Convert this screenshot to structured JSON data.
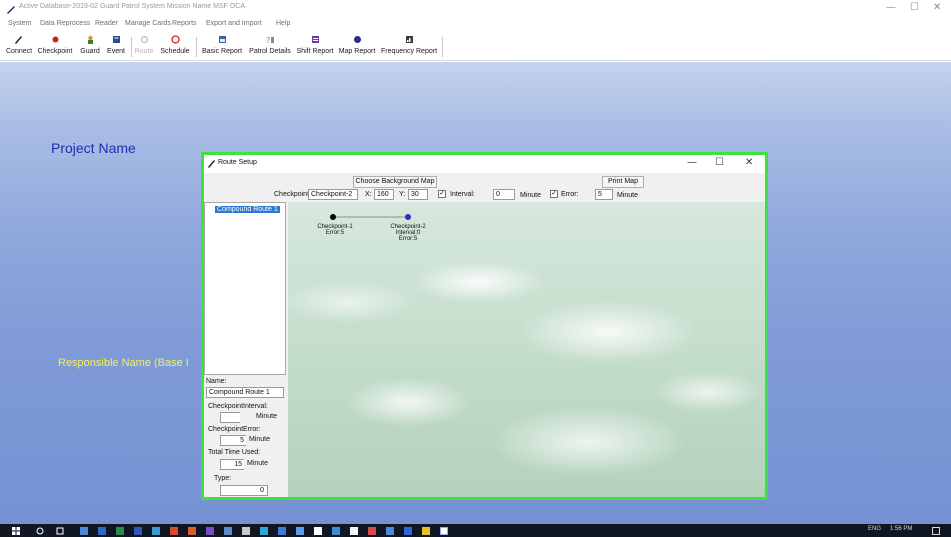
{
  "window": {
    "title": "Active Database-2019-02  Guard Patrol System Mission Name  MSF OCA",
    "minimize": "—",
    "maximize": "☐",
    "close": "✕"
  },
  "menu": [
    "System",
    "Data Reprocess",
    "Reader",
    "Manage Cards",
    "Reports",
    "Export and Import",
    "Help"
  ],
  "toolbar": {
    "connect": "Connect",
    "checkpoint": "Checkpoint",
    "guard": "Guard",
    "event": "Event",
    "route": "Route",
    "schedule": "Schedule",
    "basic_report": "Basic Report",
    "patrol_details": "Patrol Details",
    "shift_report": "Shift Report",
    "map_report": "Map Report",
    "frequency_report": "Frequency Report",
    "icon_colors": {
      "connect": "#1a1a1a",
      "checkpoint": "#d0201a",
      "guard": "#c8a020",
      "event": "#2a4a9a",
      "route": "#b8b8b8",
      "schedule": "#d02020",
      "basic_report": "#4060a0",
      "patrol_details": "#8a8a8a",
      "shift_report": "#6a3aa0",
      "map_report": "#2a2a8a",
      "frequency_report": "#3a3a3a"
    }
  },
  "background": {
    "project_name": "Project Name",
    "responsible_name": "Responsible Name (Base I"
  },
  "route_setup": {
    "title": "Route Setup",
    "choose_bg_map": "Choose Background Map",
    "print_map": "Print Map",
    "checkpoint_label": "Checkpoint:",
    "checkpoint_value": "Checkpoint-2",
    "x_label": "X:",
    "x_value": "160",
    "y_label": "Y:",
    "y_value": "30",
    "interval_check": "✓",
    "interval_label": "Interval:",
    "interval_value": "0",
    "interval_unit": "Minute",
    "error_check": "✓",
    "error_label": "Error:",
    "error_value": "5",
    "error_unit": "Minute",
    "tree_item": "Compound Route 1",
    "name_label": "Name:",
    "name_value": "Compound Route 1",
    "cp_interval_label": "CheckpointInterval:",
    "cp_interval_value": "",
    "cp_interval_unit": "Minute",
    "cp_error_label": "CheckpointError:",
    "cp_error_value": "5",
    "cp_error_unit": "Minute",
    "total_time_label": "Total Time Used:",
    "total_time_value": "15",
    "total_time_unit": "Minute",
    "type_label": "Type:",
    "type_value": "0",
    "map_points": [
      {
        "line1": "Checkpoint-1",
        "line2": "Error:5",
        "line3": "",
        "color": "#000000"
      },
      {
        "line1": "Checkpoint-2",
        "line2": "Interval:0",
        "line3": "Error:5",
        "color": "#2a2ad0"
      }
    ]
  },
  "tray": {
    "lang": "ENG",
    "time": "1:56 PM"
  }
}
